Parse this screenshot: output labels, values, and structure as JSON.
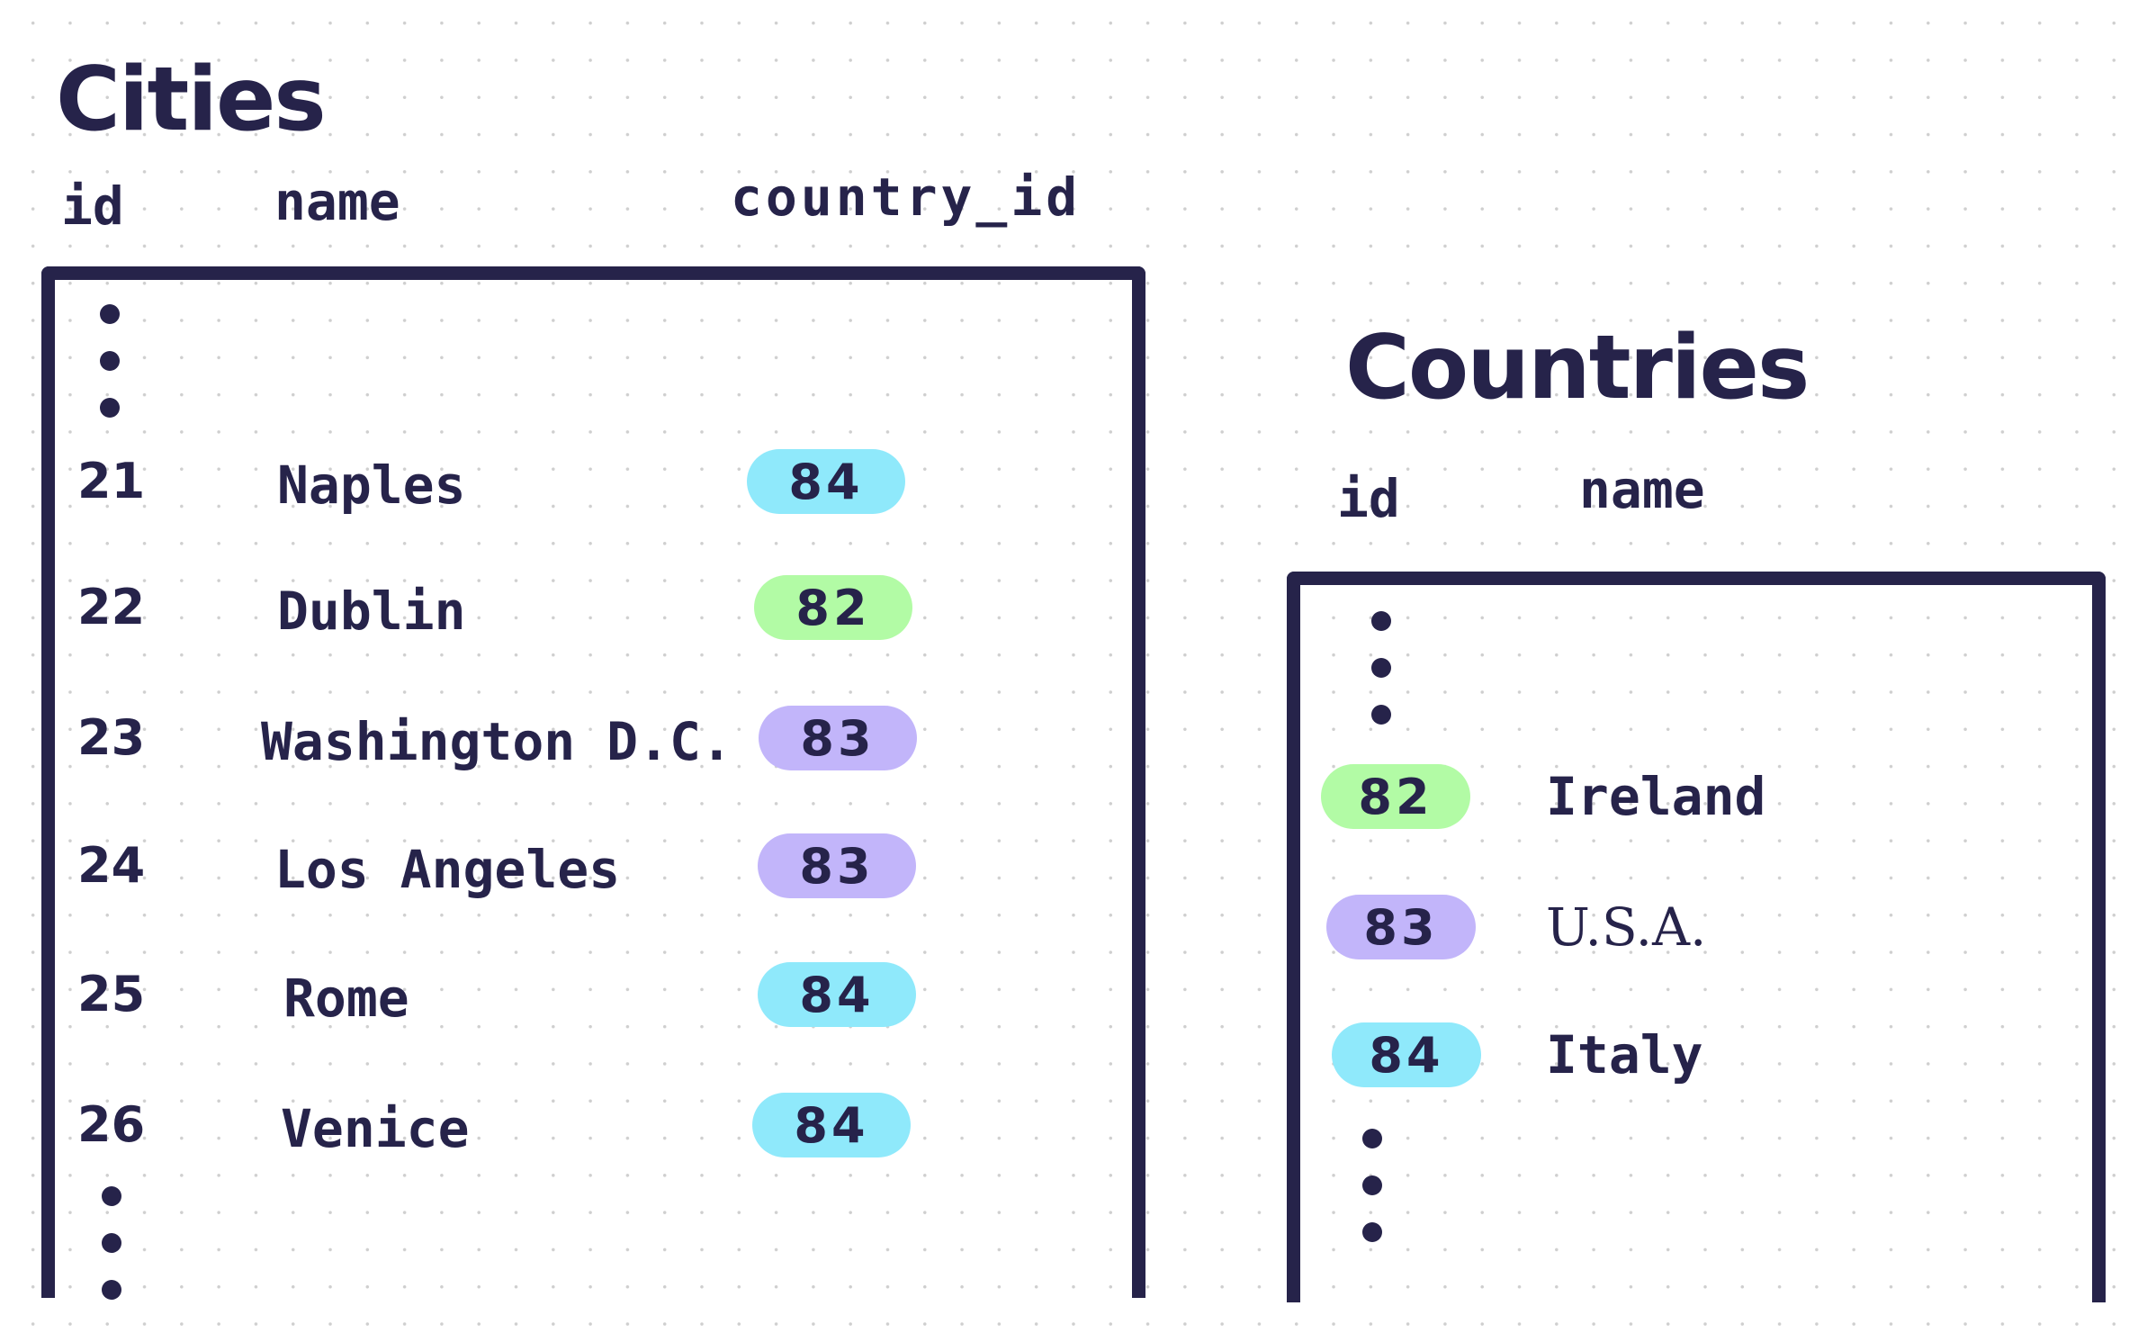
{
  "colors": {
    "ink": "#26234a",
    "country_82": "#b2fba5",
    "country_83": "#c2b5fa",
    "country_84": "#8fe9fb"
  },
  "cities": {
    "title": "Cities",
    "headers": {
      "id": "id",
      "name": "name",
      "country_id": "country_id"
    },
    "ellipsis_top": "more-rows-icon",
    "rows": [
      {
        "id": "21",
        "name": "Naples",
        "country_id": "84"
      },
      {
        "id": "22",
        "name": "Dublin",
        "country_id": "82"
      },
      {
        "id": "23",
        "name": "Washington D.C.",
        "country_id": "83"
      },
      {
        "id": "24",
        "name": "Los Angeles",
        "country_id": "83"
      },
      {
        "id": "25",
        "name": "Rome",
        "country_id": "84"
      },
      {
        "id": "26",
        "name": "Venice",
        "country_id": "84"
      }
    ],
    "ellipsis_bottom": "more-rows-icon"
  },
  "countries": {
    "title": "Countries",
    "headers": {
      "id": "id",
      "name": "name"
    },
    "ellipsis_top": "more-rows-icon",
    "rows": [
      {
        "id": "82",
        "name": "Ireland"
      },
      {
        "id": "83",
        "name": "U.S.A."
      },
      {
        "id": "84",
        "name": "Italy"
      }
    ],
    "ellipsis_bottom": "more-rows-icon"
  }
}
